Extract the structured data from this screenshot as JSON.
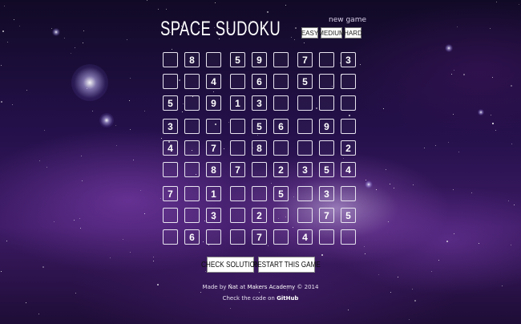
{
  "header": {
    "title": "SPACE SUDOKU",
    "new_game_label": "new game",
    "difficulty": [
      "EASY",
      "MEDIUM",
      "HARD"
    ]
  },
  "grid": [
    [
      "",
      "8",
      "",
      "5",
      "9",
      "",
      "7",
      "",
      "3"
    ],
    [
      "",
      "",
      "4",
      "",
      "6",
      "",
      "5",
      "",
      ""
    ],
    [
      "5",
      "",
      "9",
      "1",
      "3",
      "",
      "",
      "",
      ""
    ],
    [
      "3",
      "",
      "",
      "",
      "5",
      "6",
      "",
      "9",
      ""
    ],
    [
      "4",
      "",
      "7",
      "",
      "8",
      "",
      "",
      "",
      "2"
    ],
    [
      "",
      "",
      "8",
      "7",
      "",
      "2",
      "3",
      "5",
      "4"
    ],
    [
      "7",
      "",
      "1",
      "",
      "",
      "5",
      "",
      "3",
      ""
    ],
    [
      "",
      "",
      "3",
      "",
      "2",
      "",
      "",
      "7",
      "5"
    ],
    [
      "",
      "6",
      "",
      "",
      "7",
      "",
      "4",
      "",
      ""
    ]
  ],
  "actions": {
    "check": "CHECK SOLUTION",
    "restart": "RESTART THIS GAME"
  },
  "footer": {
    "made_prefix": "Made by",
    "author": "Nat",
    "made_at": "at",
    "academy": "Makers Academy",
    "year": "© 2014",
    "code_prefix": "Check the code on",
    "github": "GitHub"
  }
}
